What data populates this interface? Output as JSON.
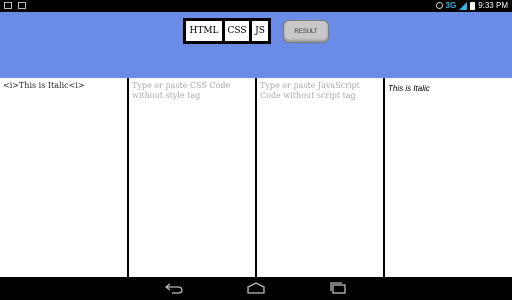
{
  "status_bar": {
    "network": "3G",
    "time": "9:33",
    "time_suffix": "PM"
  },
  "toolbar": {
    "tabs": [
      "HTML",
      "CSS",
      "JS"
    ],
    "result_label": "RESULT"
  },
  "panels": {
    "html_code": "<i>This is Italic<i>",
    "css_placeholder": "Type or paste CSS Code without style tag",
    "js_placeholder": "Type or paste JavaScript Code without script tag",
    "result_text": "This is Italic"
  },
  "colors": {
    "toolbar_bg": "#6a8be6",
    "result_button": "#c8c8c8"
  }
}
